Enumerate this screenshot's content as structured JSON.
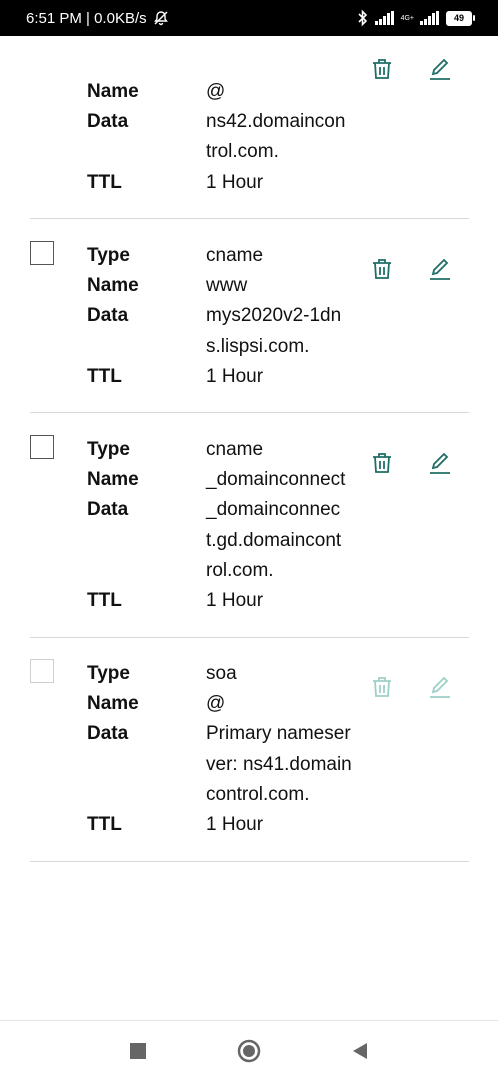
{
  "status_bar": {
    "time_speed": "6:51 PM | 0.0KB/s",
    "network_label": "4G+",
    "battery": "49"
  },
  "labels": {
    "type": "Type",
    "name": "Name",
    "data": "Data",
    "ttl": "TTL"
  },
  "records": [
    {
      "name": "@",
      "data_lines": [
        "ns42.domaincon",
        "trol.com."
      ],
      "ttl": "1 Hour"
    },
    {
      "type": "cname",
      "name": "www",
      "data_lines": [
        "mys2020v2-1dn",
        "s.lispsi.com."
      ],
      "ttl": "1 Hour"
    },
    {
      "type": "cname",
      "name": "_domainconnect",
      "data_lines": [
        "_domainconnec",
        "t.gd.domaincont",
        "rol.com."
      ],
      "ttl": "1 Hour"
    },
    {
      "type": "soa",
      "name": "@",
      "data_lines": [
        "Primary nameser",
        "ver: ns41.domain",
        "control.com."
      ],
      "ttl": "1 Hour",
      "disabled": true
    }
  ],
  "icons": {
    "delete": "trash-icon",
    "edit": "pencil-icon",
    "nav_recent": "square-icon",
    "nav_home": "circle-icon",
    "nav_back": "triangle-back-icon"
  },
  "colors": {
    "action_teal": "#1f6f66",
    "action_disabled": "#9fcfc9",
    "text": "#111111",
    "divider": "#d8d8d8"
  }
}
